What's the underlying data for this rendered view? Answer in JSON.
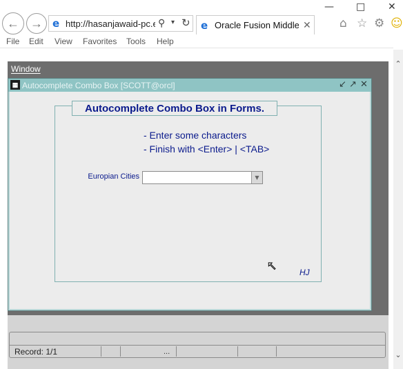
{
  "browser": {
    "address_url": "http://hasanjawaid-pc.e",
    "tab_title": "Oracle Fusion Middle...",
    "menu": [
      "File",
      "Edit",
      "View",
      "Favorites",
      "Tools",
      "Help"
    ]
  },
  "oracle_menu": "Window",
  "form": {
    "window_title": "Autocomplete Combo Box  [SCOTT@orcl]",
    "group_title": "Autocomplete Combo Box in Forms.",
    "hint1": "- Enter some characters",
    "hint2": "- Finish with <Enter> | <TAB>",
    "city_label": "Europian Cities",
    "city_value": "",
    "signature": "HJ"
  },
  "status": {
    "record": "Record: 1/1",
    "dots": "..."
  }
}
